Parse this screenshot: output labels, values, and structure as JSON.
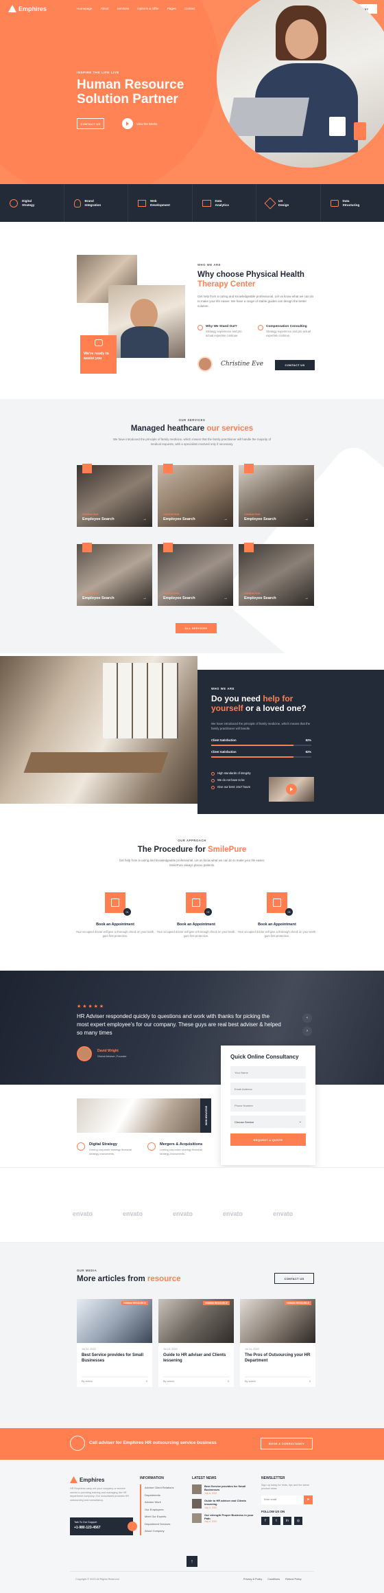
{
  "header": {
    "brand": "Emphires",
    "nav": [
      "Homepage",
      "About",
      "Services",
      "Options & Offer",
      "Pages",
      "Contact"
    ],
    "cta": "MAKE APPOINTMENT"
  },
  "hero": {
    "kicker": "INSPIRE THE LIFE LIVE",
    "title_line1": "Human Resource",
    "title_line2": "Solution Partner",
    "btn_contact": "CONTACT US",
    "btn_video": "View the Works"
  },
  "services_bar": [
    {
      "l1": "Digital",
      "l2": "Strategy"
    },
    {
      "l1": "Brand",
      "l2": "Integration"
    },
    {
      "l1": "Web",
      "l2": "Development"
    },
    {
      "l1": "Data",
      "l2": "Analytics"
    },
    {
      "l1": "UX",
      "l2": "Design"
    },
    {
      "l1": "Data",
      "l2": "Structuring"
    }
  ],
  "why": {
    "kicker": "WHO WE ARE",
    "title1": "Why choose Physical Health",
    "title2": "Therapy Center",
    "text": "Get help from a caring and knowledgeable professional. Let us know what we can do to make your life easier. We have a range of stable guides can design the better solution.",
    "badge": "We're ready to assist you",
    "f1_title": "Why We Stand Out?",
    "f1_text": "Strategy experience and pro actual expertise continue.",
    "f2_title": "Compensation Consulting",
    "f2_text": "Strategy experience and pro actual expertise continue.",
    "signature": "Christine Eve",
    "btn": "CONTACT US"
  },
  "services": {
    "kicker": "OUR SERVICES",
    "title1": "Managed heathcare ",
    "title2": "our services",
    "text": "We have introduced the principle of family medicine, which means that the family practitioner will handle the majority of medical requests, with a specialists involved only if necessary.",
    "cards": [
      {
        "tag": "CONSULTING",
        "title": "Employee Search"
      },
      {
        "tag": "CONSULTING",
        "title": "Employee Search"
      },
      {
        "tag": "CONSULTING",
        "title": "Employee Search"
      },
      {
        "tag": "CONSULTING",
        "title": "Employee Search"
      },
      {
        "tag": "CONSULTING",
        "title": "Employee Search"
      },
      {
        "tag": "CONSULTING",
        "title": "Employee Search"
      }
    ],
    "btn": "ALL SERVICES"
  },
  "help": {
    "kicker": "WHO WE ARE",
    "title1": "Do you need ",
    "title2": "help for",
    "title3": "yourself",
    "title4": " or a loved one?",
    "text": "We have introduced the principle of family medicine, which means that the family practitioner will handle.",
    "bars": [
      {
        "label": "Client Satisfaction",
        "pct": "82%",
        "value": 0.82
      },
      {
        "label": "Client Satisfaction",
        "pct": "82%",
        "value": 0.82
      }
    ],
    "list": [
      "High standards of integrity",
      "We do not have to be",
      "Give our best: 24x7 hours"
    ]
  },
  "procedure": {
    "kicker": "OUR APPROACH",
    "title1": "The Procedure for ",
    "title2": "SmilePure",
    "text": "Get help from a caring and knowledgeable professional. Let us know what we can do to make your life easier. SmilePure always places patients.",
    "steps": [
      {
        "num": "01",
        "title": "Book an Appointment",
        "text": "Your occupied doctor will give a thorough check on your teeth, gum first protection.",
        "title_val": "Book an Appointment"
      },
      {
        "num": "02",
        "title": "Book an Appointment",
        "text": "Your occupied doctor will give a thorough check on your teeth, gum first protection."
      },
      {
        "num": "03",
        "title": "Book an Appointment",
        "text": "Your occupied doctor will give a thorough check on your teeth, gum first protection."
      }
    ]
  },
  "testimonial": {
    "stars": "★ ★ ★ ★ ★",
    "quote": "HR Adviser responded quickly to questions and work with thanks for picking the most expert employee's for our company. These guys are real best adviser & helped so many times",
    "name": "David Wright",
    "role": "Global Adviser, Founder"
  },
  "consult": {
    "title": "Quick Online Consultancy",
    "f1": "Your Name",
    "f2": "Email Address",
    "f3": "Phone Number",
    "select": "Choose Service",
    "btn": "REQUEST A QUOTE"
  },
  "mini": {
    "badge": "DISCOVER NOW",
    "s1_title": "Digital Strategy",
    "s1_text": "Linking corporate strategy financial strategy instruments.",
    "s2_title": "Mergers & Acquisitions",
    "s2_text": "Linking corporate strategy financial strategy instruments."
  },
  "logos": [
    "envato",
    "envato",
    "envato",
    "envato",
    "envato"
  ],
  "blog": {
    "kicker": "OUR MEDIA",
    "title1": "More articles from ",
    "title2": "resource",
    "btn": "CONTACT US",
    "posts": [
      {
        "tag": "HUMAN RESOURCE",
        "date": "Jul 14, 2022",
        "title": "Best Service provides for Small Businesses",
        "by": "By admin",
        "count": "0"
      },
      {
        "tag": "HUMAN RESOURCE",
        "date": "Jul 14, 2022",
        "title": "Guide to HR adviser and Clients lessening",
        "by": "By admin",
        "count": "0"
      },
      {
        "tag": "HUMAN RESOURCE",
        "date": "Jul 14, 2022",
        "title": "The Pros of Outsourcing your HR Department",
        "by": "By admin",
        "count": "0"
      }
    ]
  },
  "cta": {
    "text": "Call adviser for Emphires HR outsourcing service business",
    "btn": "BOOK A CONSULTANCY"
  },
  "footer": {
    "brand": "Emphires",
    "about": "HR Emphires carry out your company or service needs to providing training and managing the HR department company. Our consultants provides HR outsourcing and consultancy.",
    "support_label": "Talk To Our Support",
    "phone": "+1-980-123-4567",
    "info_title": "INFORMATION",
    "info": [
      "Adviser Client Relations",
      "Departments",
      "Adviser Work",
      "Our Employees",
      "Meet Our Experts",
      "Department Services",
      "About Company"
    ],
    "news_title": "LATEST NEWS",
    "news": [
      {
        "t": "Best Service provides for Small Businesses",
        "d": "July 6, 2022"
      },
      {
        "t": "Guide to HR adviser and Clients lessening",
        "d": "July 6, 2022"
      },
      {
        "t": "Our strength Proper Business in your Path",
        "d": "July 6, 2022"
      }
    ],
    "nl_title": "NEWSLETTER",
    "nl_text": "Sign up today for hints, tips and the latest product news",
    "nl_placeholder": "Enter email",
    "follow": "FOLLOW US ON",
    "copyright": "Copyright © 2022 All Rights Reserved",
    "links": [
      "Privacy & Policy",
      "Conditions",
      "Refund Policy"
    ]
  },
  "colors": {
    "accent": "#ff7f50",
    "dark": "#1f2533"
  }
}
